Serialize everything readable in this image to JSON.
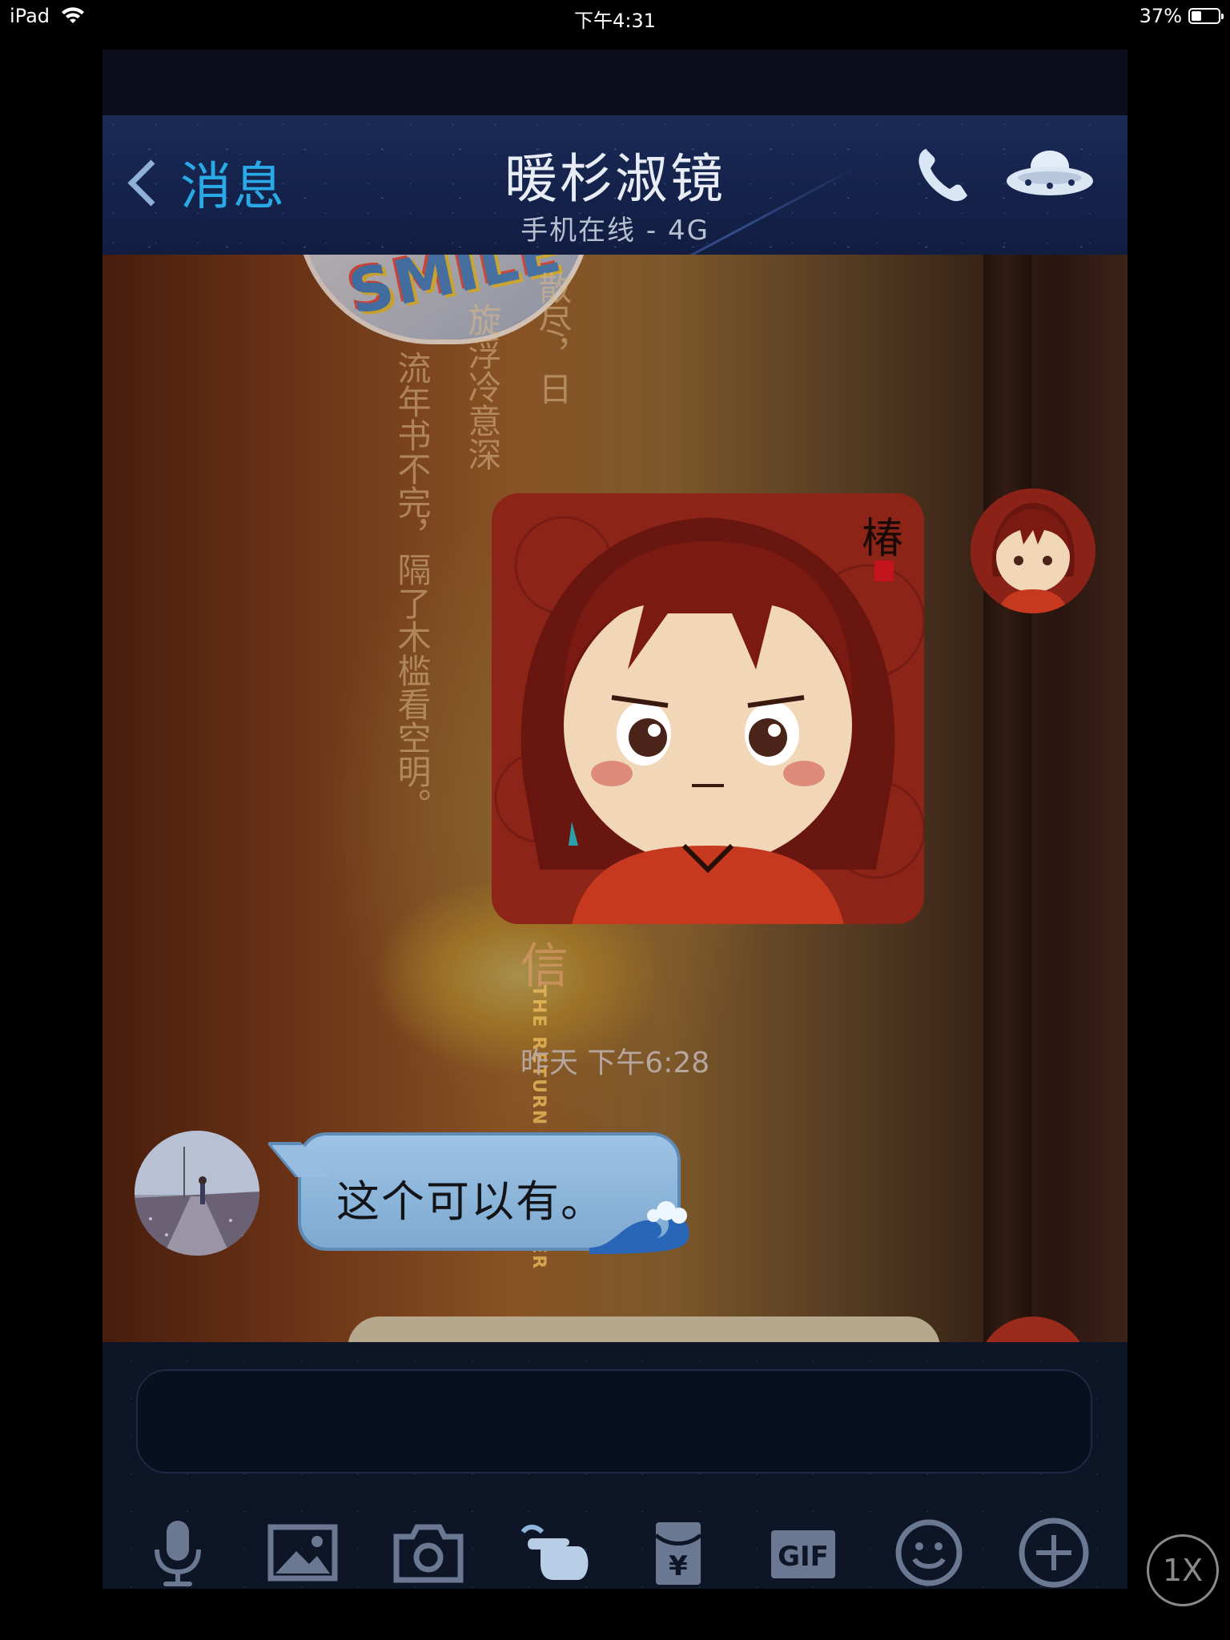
{
  "status_bar": {
    "device": "iPad",
    "time": "下午4:31",
    "battery_percent": "37%",
    "battery_level": 0.37
  },
  "nav": {
    "back_label": "消息",
    "title": "暖杉淑镜",
    "subtitle": "手机在线 - 4G",
    "icons": [
      "back-chevron-icon",
      "phone-icon",
      "ufo-icon"
    ]
  },
  "background": {
    "poem_col1": "流年书不完，隔了木槛看空明。",
    "poem_col2": "旋浮冷意深",
    "poem_col3": "散尽，日",
    "smile_text": "SMILE",
    "xin_char": "信",
    "english_text": "THE RETURN OF FOR HER"
  },
  "chat": {
    "sticker_stamp": "椿",
    "timestamp": "昨天 下午6:28",
    "message_text": "这个可以有。"
  },
  "composer": {
    "input_value": "",
    "tools": [
      "microphone-icon",
      "image-icon",
      "camera-icon",
      "poke-icon",
      "red-packet-icon",
      "gif-icon",
      "emoji-icon",
      "plus-icon"
    ],
    "gif_label": "GIF",
    "red_packet_symbol": "¥"
  },
  "zoom_label": "1X",
  "colors": {
    "accent_blue": "#29a9e6",
    "nav_bg": "#14224a",
    "bubble_blue": "#8fb7dd"
  }
}
